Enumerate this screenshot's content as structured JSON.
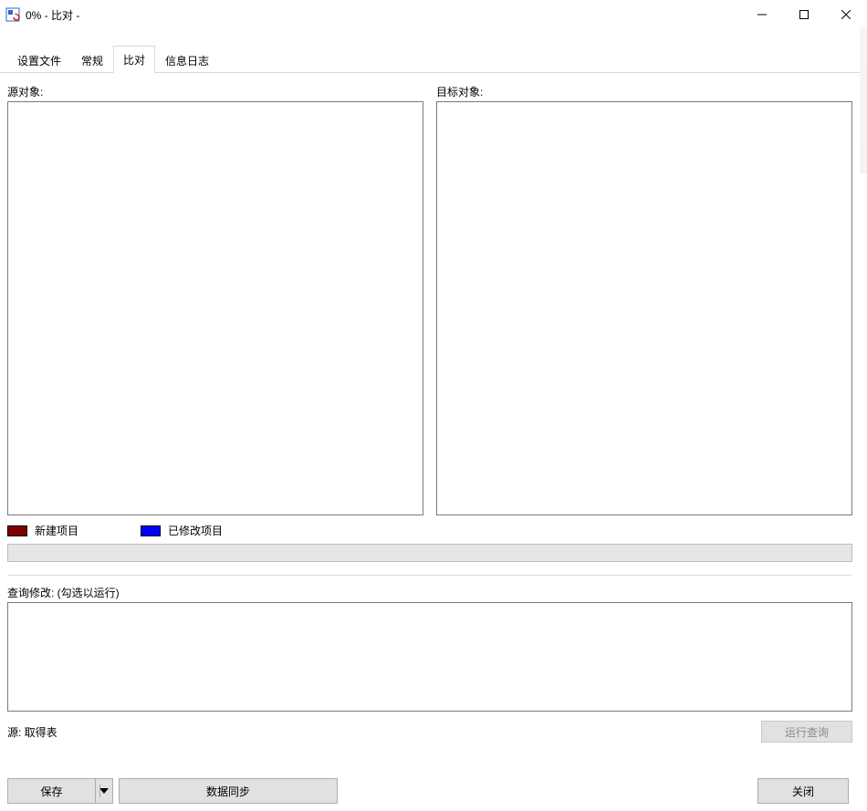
{
  "window": {
    "title": "0% - 比对 -"
  },
  "tabs": {
    "settings": "设置文件",
    "general": "常规",
    "compare": "比对",
    "log": "信息日志"
  },
  "compare": {
    "source_label": "源对象:",
    "target_label": "目标对象:",
    "legend_new": "新建项目",
    "legend_modified": "已修改项目",
    "query_label": "查询修改: (勾选以运行)",
    "source_status": "源: 取得表",
    "run_query": "运行查询"
  },
  "buttons": {
    "save": "保存",
    "sync": "数据同步",
    "close": "关闭"
  },
  "colors": {
    "new_item": "#800000",
    "modified_item": "#0000ff"
  }
}
